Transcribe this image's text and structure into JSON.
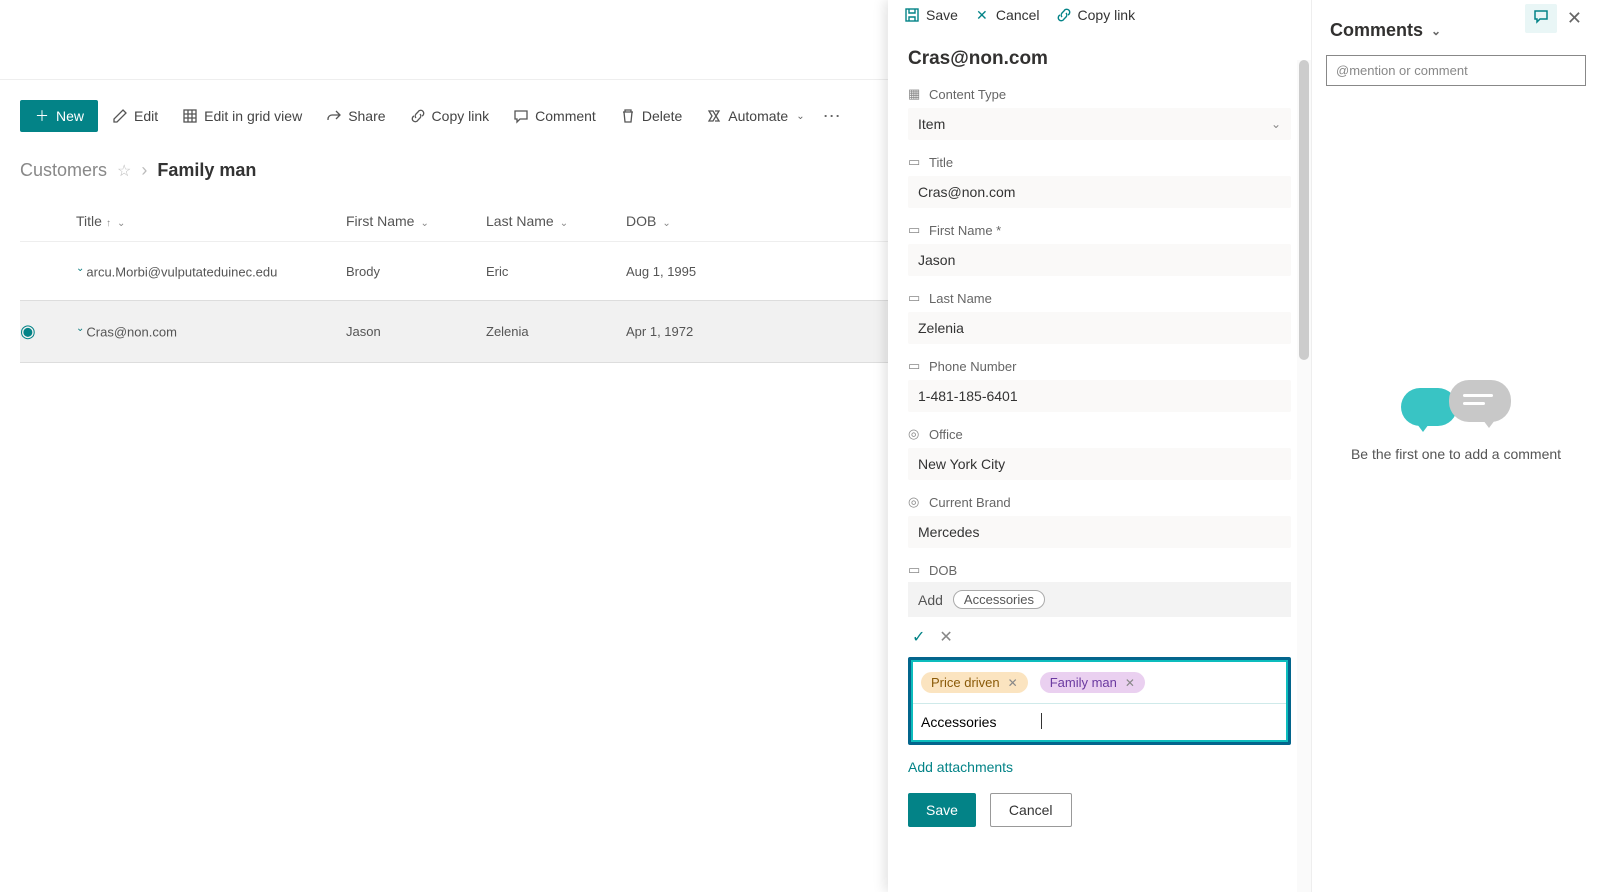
{
  "toolbar": {
    "new": "New",
    "edit": "Edit",
    "edit_grid": "Edit in grid view",
    "share": "Share",
    "copy_link": "Copy link",
    "comment": "Comment",
    "delete": "Delete",
    "automate": "Automate"
  },
  "breadcrumb": {
    "root": "Customers",
    "leaf": "Family man"
  },
  "columns": {
    "title": "Title",
    "first": "First Name",
    "last": "Last Name",
    "dob": "DOB"
  },
  "rows": [
    {
      "title": "arcu.Morbi@vulputateduinec.edu",
      "first": "Brody",
      "last": "Eric",
      "dob": "Aug 1, 1995",
      "selected": false
    },
    {
      "title": "Cras@non.com",
      "first": "Jason",
      "last": "Zelenia",
      "dob": "Apr 1, 1972",
      "selected": true
    }
  ],
  "panel": {
    "actions": {
      "save": "Save",
      "cancel": "Cancel",
      "copy_link": "Copy link"
    },
    "item_title": "Cras@non.com",
    "fields": {
      "content_type": {
        "label": "Content Type",
        "value": "Item"
      },
      "title": {
        "label": "Title",
        "value": "Cras@non.com"
      },
      "first_name": {
        "label": "First Name *",
        "value": "Jason"
      },
      "last_name": {
        "label": "Last Name",
        "value": "Zelenia"
      },
      "phone": {
        "label": "Phone Number",
        "value": "1-481-185-6401"
      },
      "office": {
        "label": "Office",
        "value": "New York City"
      },
      "brand": {
        "label": "Current Brand",
        "value": "Mercedes"
      },
      "dob": {
        "label": "DOB"
      }
    },
    "tag_suggest": {
      "add_label": "Add",
      "suggestion": "Accessories"
    },
    "tags": [
      {
        "text": "Price driven",
        "color": "orange"
      },
      {
        "text": "Family man",
        "color": "purple"
      }
    ],
    "tag_input": "Accessories",
    "add_attachments": "Add attachments",
    "buttons": {
      "save": "Save",
      "cancel": "Cancel"
    }
  },
  "comments": {
    "heading": "Comments",
    "placeholder": "@mention or comment",
    "empty": "Be the first one to add a comment"
  }
}
